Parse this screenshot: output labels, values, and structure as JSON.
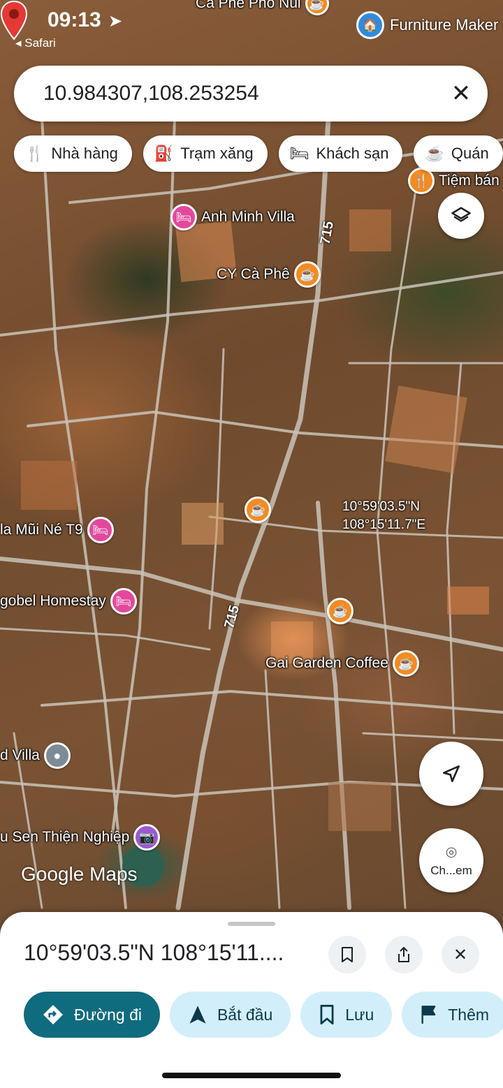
{
  "status_bar": {
    "time": "09:13",
    "back_label": "◂ Safari",
    "right_label": "Furniture Maker"
  },
  "search": {
    "query": "10.984307,108.253254",
    "close_glyph": "✕"
  },
  "chips": [
    {
      "label": "Nhà hàng",
      "icon": "restaurant-icon",
      "glyph": "🍴"
    },
    {
      "label": "Trạm xăng",
      "icon": "gas-station-icon",
      "glyph": "⛽"
    },
    {
      "label": "Khách sạn",
      "icon": "hotel-icon",
      "glyph": "🛏"
    },
    {
      "label": "Quán",
      "icon": "cafe-icon",
      "glyph": "☕"
    }
  ],
  "map": {
    "road_label_1": "715",
    "road_label_2": "715",
    "pois": {
      "top_cafe": "Cà Phê Phố Núi",
      "tiem_banh": "Tiệm bán",
      "anh_minh": "Anh Minh Villa",
      "cy_cafe": "CY Cà Phê",
      "mui_ne": "la Mũi Né T9",
      "gobel": "gobel Homestay",
      "gai_garden": "Gai Garden Coffee",
      "d_villa": "d Villa",
      "sen": "u Sen Thiện Nghiệp"
    },
    "pin_lat": "10°59'03.5\"N",
    "pin_lng": "108°15'11.7\"E",
    "attribution": "Google Maps"
  },
  "fabs": {
    "lens_label": "Ch...em"
  },
  "sheet": {
    "title": "10°59'03.5\"N 108°15'11....",
    "actions": [
      {
        "label": "Đường đi",
        "icon": "directions-icon",
        "glyph": "➜"
      },
      {
        "label": "Bắt đầu",
        "icon": "navigation-icon",
        "glyph": "▲"
      },
      {
        "label": "Lưu",
        "icon": "bookmark-icon",
        "glyph": "🔖"
      },
      {
        "label": "Thêm",
        "icon": "flag-icon",
        "glyph": "⚑"
      }
    ]
  },
  "colors": {
    "primary_action": "#0f6b7e",
    "secondary_action": "#d3eefb",
    "pin": "#e53935",
    "poi_orange": "#f28b22",
    "poi_pink": "#e2499d"
  }
}
